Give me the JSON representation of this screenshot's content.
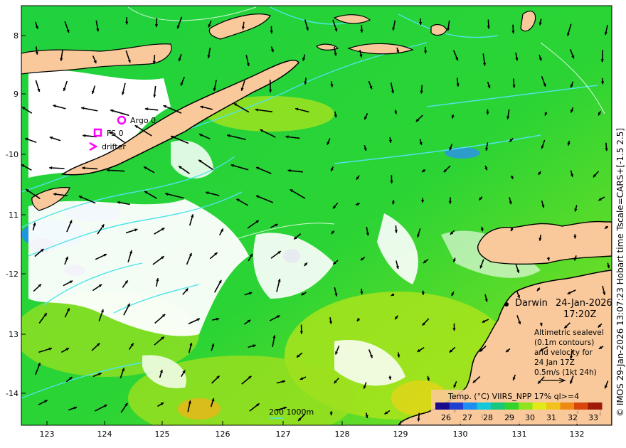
{
  "map": {
    "lon_ticks": [
      "123",
      "124",
      "125",
      "126",
      "127",
      "128",
      "129",
      "130",
      "131",
      "132"
    ],
    "lat_ticks": [
      "8",
      "9",
      "-10",
      "11",
      "-12",
      "13",
      "-14"
    ],
    "legend": {
      "argo": "Argo 0",
      "fs": "FS 0",
      "drifter": "drifter"
    },
    "location": "Darwin",
    "date": "24-Jan-2026",
    "time": "17:20Z",
    "altimetry_note": [
      "Altimetric sealevel",
      "(0.1m contours)",
      "and velocity for",
      "24 Jan 17Z",
      "0.5m/s (1kt 24h)"
    ],
    "scale_label": "200  1000m",
    "colorbar_title": "Temp. (°C) VIIRS_NPP 17% ql>=4",
    "colorbar_ticks": [
      "26",
      "27",
      "28",
      "29",
      "30",
      "31",
      "32",
      "33"
    ],
    "colorbar_colors": [
      "#1a0a8c",
      "#1f3fd0",
      "#1e8ff0",
      "#13c8d8",
      "#15c87a",
      "#31d42a",
      "#8ee31c",
      "#e0ea17",
      "#f2c21a",
      "#ee8a12",
      "#d8460c",
      "#a01a08"
    ],
    "credit": "© IMOS 29-Jan-2026 13:07:23 Hobart time Tscale=CARS+[-1.5 2.5]",
    "colors": {
      "land": "#f9c99c",
      "coast": "#000000",
      "contour": "#4fe3ea",
      "marker": "#ff00ff"
    }
  }
}
